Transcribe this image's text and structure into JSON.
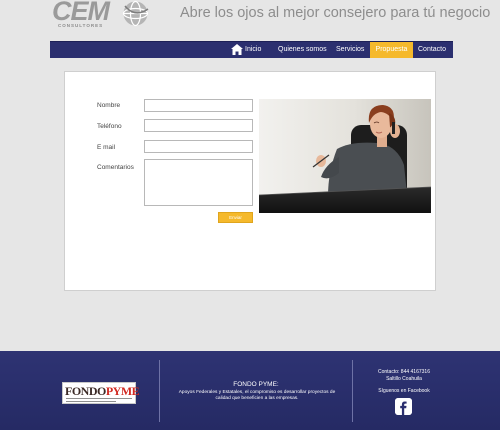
{
  "header": {
    "logo_text": "CEM",
    "logo_sub": "CONSULTORES",
    "tagline": "Abre los ojos al mejor consejero para tú negocio"
  },
  "nav": {
    "items": [
      {
        "label": "Inicio"
      },
      {
        "label": "Quienes somos"
      },
      {
        "label": "Servicios"
      },
      {
        "label": "Propuesta"
      },
      {
        "label": "Contacto"
      }
    ],
    "active_color": "#f5b92c",
    "bar_color": "#2b2f6f"
  },
  "form": {
    "name_label": "Nombre",
    "phone_label": "Teléfono",
    "email_label": "E mail",
    "comments_label": "Comentarios",
    "submit_label": "Enviar"
  },
  "footer": {
    "logo_fondo": "FONDO",
    "logo_pyme": "PYME",
    "title": "FONDO PYME:",
    "description": "Apoyos Federales y Estatales, el compromiso es desarrollar proyectos de calidad que beneficien a las empresas.",
    "contact_line": "Contacto: 844 4167316",
    "location": "Saltillo Coahuila",
    "follow": "Síguenos en Facebook",
    "background": "#2b2f6f"
  }
}
